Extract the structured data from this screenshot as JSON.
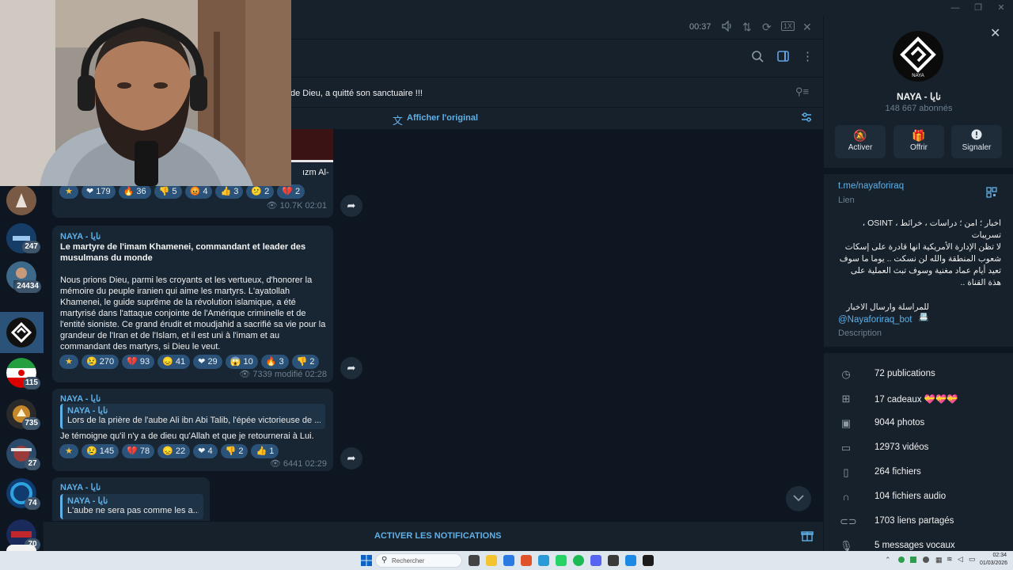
{
  "audio_player": {
    "time": "00:37",
    "speed": "1X"
  },
  "pinned": {
    "text": "de Dieu, a quitté son sanctuaire !!!"
  },
  "translate": {
    "label": "Afficher l'original"
  },
  "folders": [
    {
      "badge": ""
    },
    {
      "badge": "247"
    },
    {
      "badge": "24434"
    },
    {
      "badge": ""
    },
    {
      "badge": "115"
    },
    {
      "badge": "735"
    },
    {
      "badge": "27"
    },
    {
      "badge": "74"
    },
    {
      "badge": "70"
    }
  ],
  "messages": {
    "m0": {
      "partial_text": "ızm Al-",
      "reactions": [
        {
          "emoji": "★",
          "count": ""
        },
        {
          "emoji": "❤",
          "count": "179"
        },
        {
          "emoji": "🔥",
          "count": "36"
        },
        {
          "emoji": "👎",
          "count": "5"
        },
        {
          "emoji": "😡",
          "count": "4"
        },
        {
          "emoji": "👍",
          "count": "3"
        },
        {
          "emoji": "😕",
          "count": "2"
        },
        {
          "emoji": "💔",
          "count": "2"
        }
      ],
      "views": "10.7K",
      "time": "02:01"
    },
    "m1": {
      "sender": "NAYA - نايا",
      "title": "Le martyre de l'imam Khamenei, commandant et leader des musulmans du monde",
      "body": "Nous prions Dieu, parmi les croyants et les vertueux, d'honorer la mémoire du peuple iranien qui aime les martyrs. L'ayatollah Khamenei, le guide suprême de la révolution islamique, a été martyrisé dans l'attaque conjointe de l'Amérique criminelle et de l'entité sioniste. Ce grand érudit et moudjahid a sacrifié sa vie pour la grandeur de l'Iran et de l'Islam, et il est uni à l'imam et au commandant des martyrs, si Dieu le veut.",
      "reactions": [
        {
          "emoji": "★",
          "count": ""
        },
        {
          "emoji": "😢",
          "count": "270"
        },
        {
          "emoji": "💔",
          "count": "93"
        },
        {
          "emoji": "😞",
          "count": "41"
        },
        {
          "emoji": "❤",
          "count": "29"
        },
        {
          "emoji": "😱",
          "count": "10"
        },
        {
          "emoji": "🔥",
          "count": "3"
        },
        {
          "emoji": "👎",
          "count": "2"
        }
      ],
      "views": "7339",
      "edited": "modifié 02:28"
    },
    "m2": {
      "sender": "NAYA - نايا",
      "quote_name": "NAYA - نايا",
      "quote_text": "Lors de la prière de l'aube  Ali ibn Abi Talib, l'épée victorieuse de ...",
      "body": "Je témoigne qu'il n'y a de dieu qu'Allah et que je retournerai à Lui.",
      "reactions": [
        {
          "emoji": "★",
          "count": ""
        },
        {
          "emoji": "😢",
          "count": "145"
        },
        {
          "emoji": "💔",
          "count": "78"
        },
        {
          "emoji": "😞",
          "count": "22"
        },
        {
          "emoji": "❤",
          "count": "4"
        },
        {
          "emoji": "👎",
          "count": "2"
        },
        {
          "emoji": "👍",
          "count": "1"
        }
      ],
      "views": "6441",
      "time": "02:29"
    },
    "m3": {
      "sender": "NAYA - نايا",
      "quote_name": "NAYA - نايا",
      "quote_text": "L'aube ne sera pas comme les a..."
    }
  },
  "bottom": {
    "notify_label": "ACTIVER LES NOTIFICATIONS"
  },
  "channel": {
    "name": "NAYA - نايا",
    "subscribers": "148 667 abonnés",
    "logo_text": "NAYA",
    "actions": [
      {
        "label": "Activer",
        "icon": "bell-off-icon"
      },
      {
        "label": "Offrir",
        "icon": "gift-icon"
      },
      {
        "label": "Signaler",
        "icon": "alert-icon"
      }
    ],
    "link": "t.me/nayaforiraq",
    "link_caption": "Lien",
    "desc_line1": "اخبار ؛ امن ؛ دراسات ، خرائط ، OSINT ، تسريبات",
    "desc_para": "لا تظن الإدارة الأمريكية انها قادرة على إسكات شعوب المنطقة والله لن نسكت .. يوما ما سوف تعيد أيام عماد مغنية وسوف تبث العملية على هذة القناة ..",
    "contact": "للمراسلة وارسال الاخبار 📇",
    "bot": "@Nayaforiraq_bot",
    "desc_caption": "Description",
    "stats": [
      {
        "icon": "publications-icon",
        "label": "72 publications"
      },
      {
        "icon": "gift-icon",
        "label": "17 cadeaux 💝💝💝"
      },
      {
        "icon": "photo-icon",
        "label": "9044 photos"
      },
      {
        "icon": "video-icon",
        "label": "12973 vidéos"
      },
      {
        "icon": "file-icon",
        "label": "264 fichiers"
      },
      {
        "icon": "headphones-icon",
        "label": "104 fichiers audio"
      },
      {
        "icon": "link-icon",
        "label": "1703 liens partagés"
      },
      {
        "icon": "mic-icon",
        "label": "5 messages vocaux"
      }
    ]
  },
  "taskbar": {
    "search_placeholder": "Rechercher",
    "time": "02:34",
    "date": "01/03/2026"
  }
}
